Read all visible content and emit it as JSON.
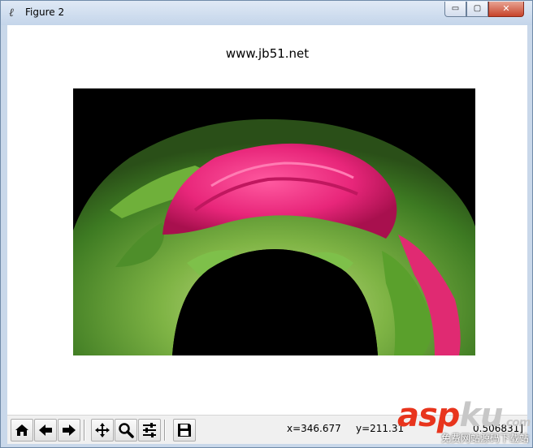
{
  "window": {
    "title": "Figure 2",
    "minimize_label": "▭",
    "maximize_label": "▢",
    "close_label": "✕"
  },
  "figure": {
    "title": "www.jb51.net"
  },
  "toolbar": {
    "buttons": [
      {
        "name": "home",
        "icon": "home-icon"
      },
      {
        "name": "back",
        "icon": "arrow-left-icon"
      },
      {
        "name": "forward",
        "icon": "arrow-right-icon"
      },
      {
        "name": "pan",
        "icon": "move-icon"
      },
      {
        "name": "zoom",
        "icon": "magnifier-icon"
      },
      {
        "name": "configure",
        "icon": "sliders-icon"
      },
      {
        "name": "save",
        "icon": "floppy-disk-icon"
      }
    ]
  },
  "status": {
    "x_readout": "x=346.677",
    "y_readout": "y=211.31",
    "pixel_readout": "0.506831]"
  },
  "watermark": {
    "logo_left": "asp",
    "logo_right": "ku",
    "logo_suffix": ".com",
    "subtitle": "免费网站源码下载站"
  },
  "colors": {
    "petal": "#e8267a",
    "leaf": "#5aa02c",
    "background": "#000000",
    "close_button": "#c7432a"
  }
}
